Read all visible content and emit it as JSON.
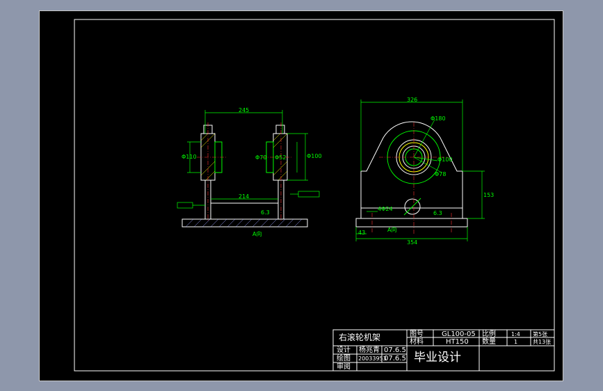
{
  "title_block": {
    "part_name": "右滚轮机架",
    "drawing_no_label": "图号",
    "drawing_no": "GL100-05",
    "material_label": "材料",
    "material": "HT150",
    "scale_label": "比例",
    "scale": "1:4",
    "quantity_label": "数量",
    "quantity": "1",
    "sheet_no": "第5张",
    "sheet_total": "共13张",
    "design_label": "设计",
    "designer": "杨兆青",
    "design_date": "07.6.5",
    "drafting_label": "绘图",
    "student_id": "20033953",
    "drafting_date": "07.6.5",
    "review_label": "审阅",
    "project": "毕业设计"
  },
  "dimensions": {
    "left_top_width": "245",
    "left_inner_width": "214",
    "left_dia_a": "Φ110",
    "left_dia_b": "Φ70",
    "left_dia_c": "Φ52",
    "left_dia_d": "Φ100",
    "right_top_width": "326",
    "right_bottom_width": "354",
    "right_height": "153",
    "right_offset": "43",
    "right_hole": "4Φ24",
    "right_dia_big": "Φ180",
    "right_dia_mid": "Φ100",
    "right_dia_small": "Φ78",
    "roughness": "6.3",
    "section_label": "A-A",
    "view_label": "A向"
  },
  "colors": {
    "outline": "#ffffff",
    "dimension": "#00ff00",
    "center": "#ff3030",
    "hatch": "#ffff00",
    "frame": "#ffffff"
  }
}
